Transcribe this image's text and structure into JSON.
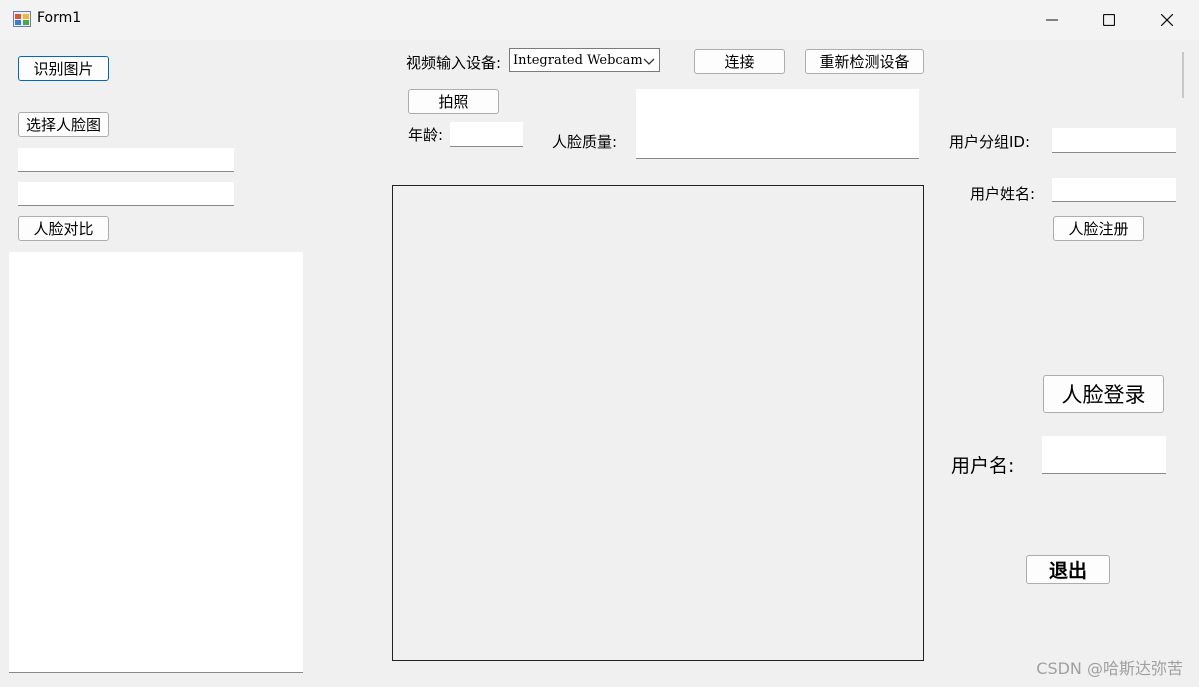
{
  "window": {
    "title": "Form1"
  },
  "titlebar_controls": {
    "minimize": "─",
    "maximize": "☐",
    "close": "✕"
  },
  "left": {
    "recognize_label": "识别图片",
    "select_face_label": "选择人脸图",
    "compare_label": "人脸对比"
  },
  "top": {
    "video_device_label": "视频输入设备:",
    "video_device_value": "Integrated Webcam",
    "connect_label": "连接",
    "redetect_label": "重新检测设备",
    "photo_label": "拍照",
    "age_label": "年龄:",
    "quality_label": "人脸质量:"
  },
  "right": {
    "group_id_label": "用户分组ID:",
    "user_name_label": "用户姓名:",
    "register_label": "人脸注册",
    "login_label": "人脸登录",
    "username_label": "用户名:",
    "exit_label": "退出"
  },
  "watermark": "CSDN @哈斯达弥苦"
}
